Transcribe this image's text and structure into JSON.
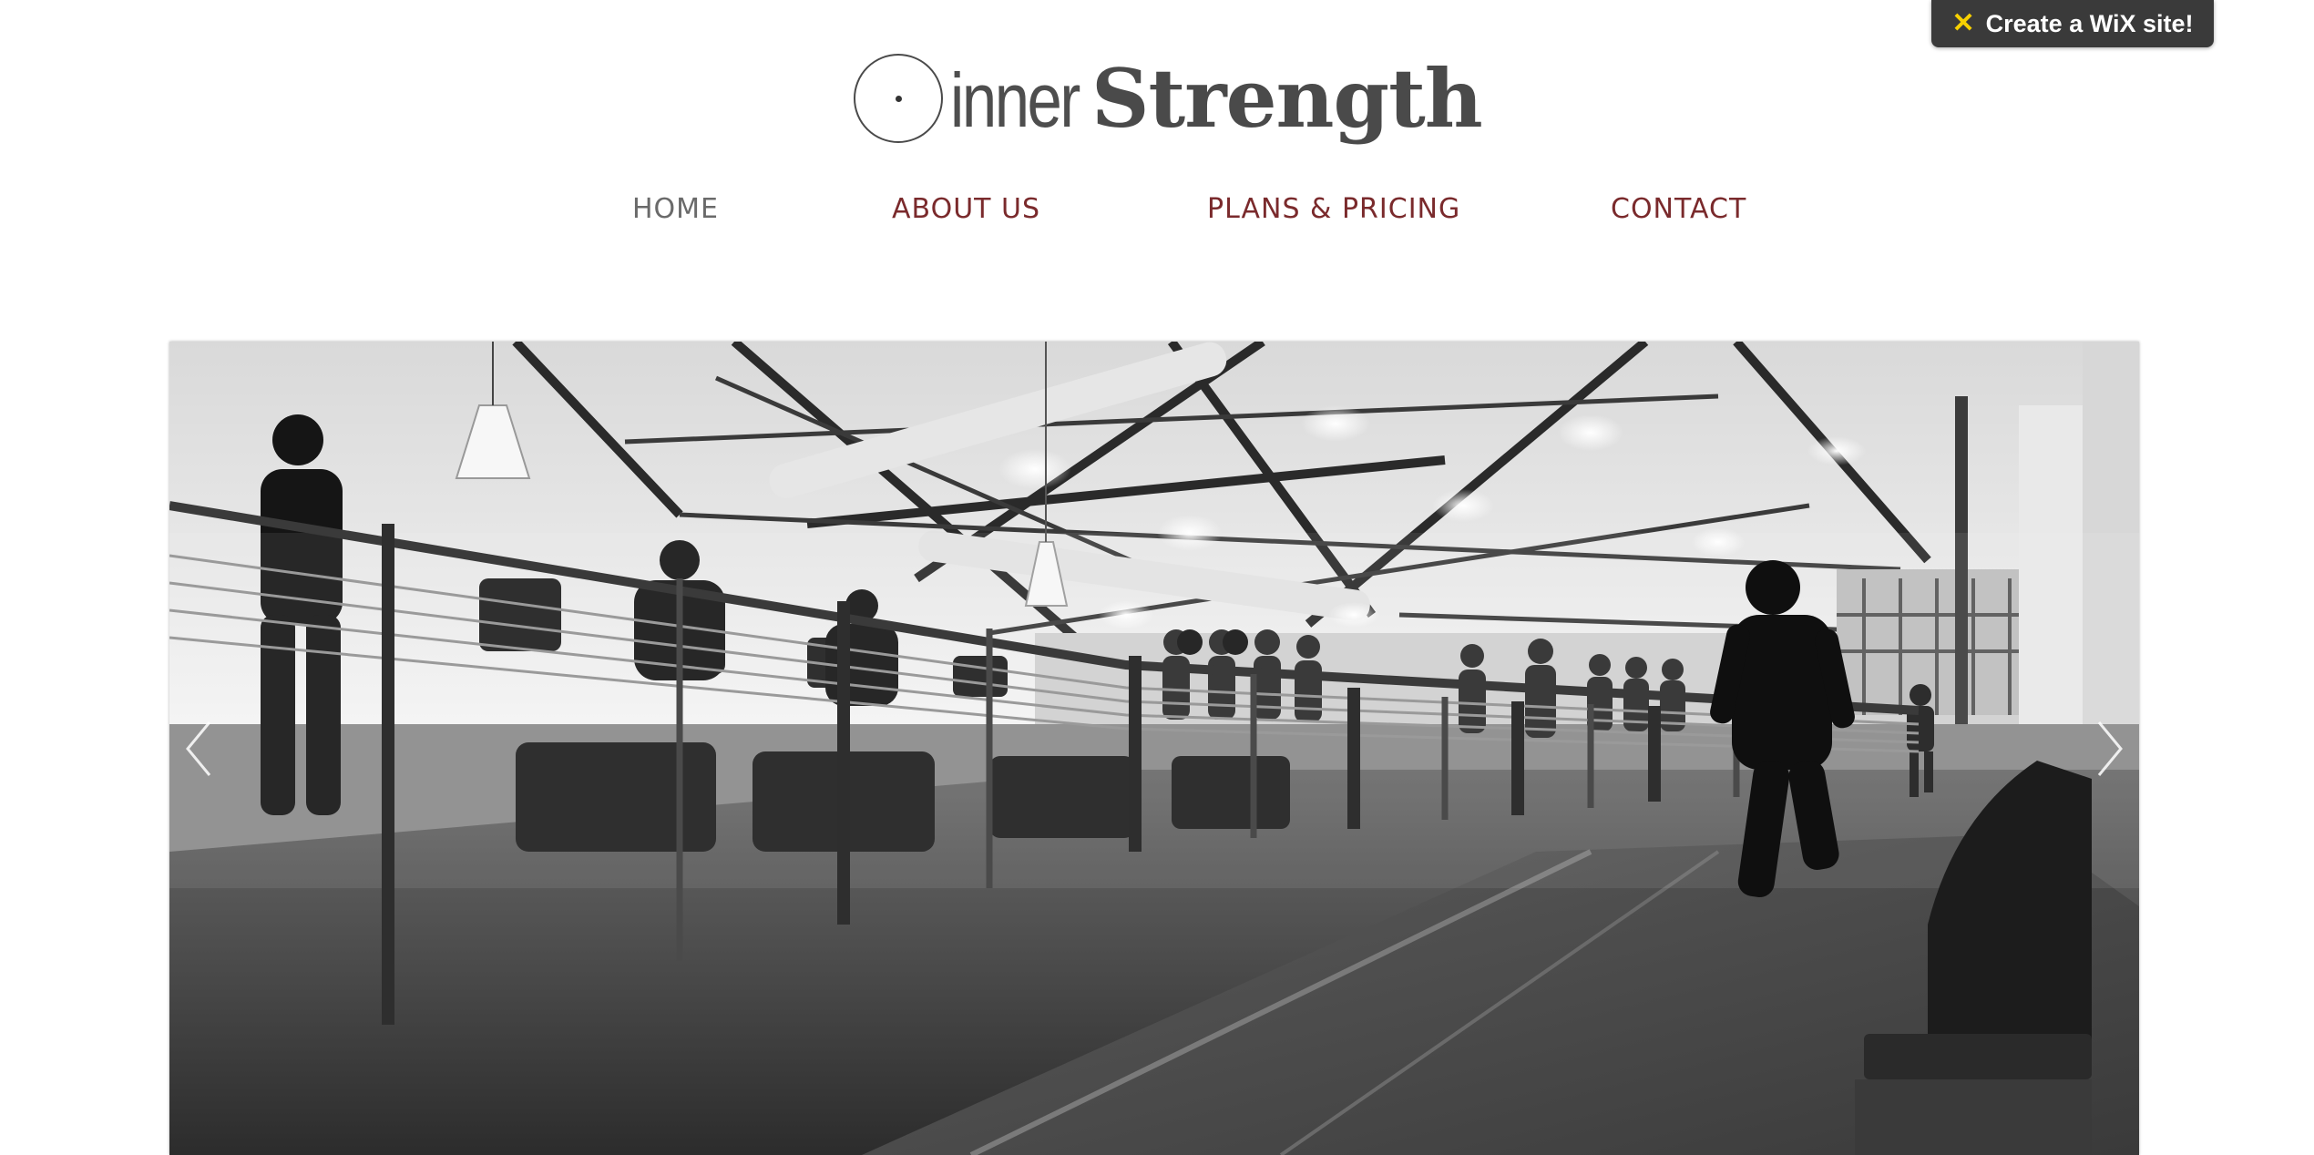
{
  "wix_banner": {
    "label": "Create a WiX site!",
    "icon": "wix-x-icon",
    "accent_color": "#f7d000"
  },
  "logo": {
    "part_light": "inner",
    "part_bold": "Strength"
  },
  "nav": {
    "items": [
      {
        "label": "HOME",
        "active": true
      },
      {
        "label": "ABOUT US",
        "active": false
      },
      {
        "label": "PLANS & PRICING",
        "active": false
      },
      {
        "label": "CONTACT",
        "active": false
      }
    ],
    "color_link": "#7a2a2c",
    "color_active": "#6a6a6a"
  },
  "hero": {
    "image": "black-and-white gym interior with treadmills and running track",
    "prev_icon": "chevron-left-icon",
    "next_icon": "chevron-right-icon"
  }
}
